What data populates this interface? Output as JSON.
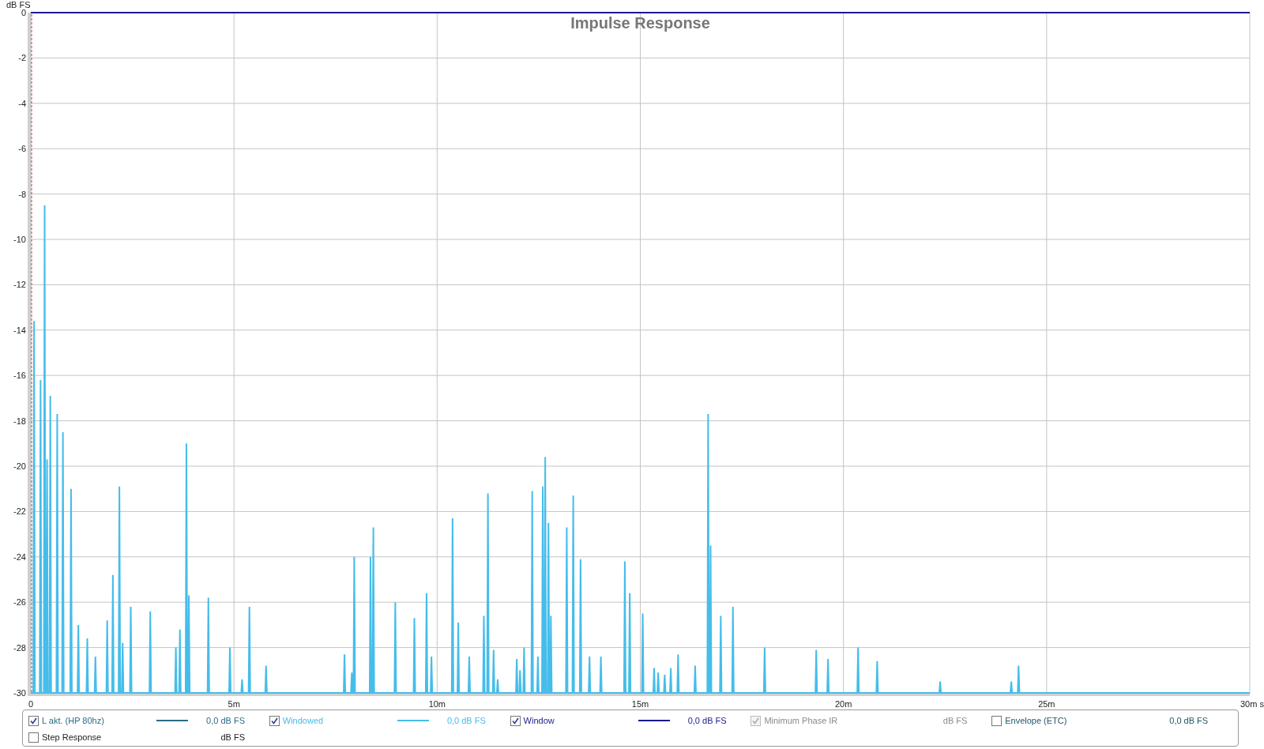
{
  "chart_data": {
    "type": "line",
    "title": "Impulse Response",
    "ylabel": "dB FS",
    "grid": true,
    "x": [
      0,
      0.06,
      0.08,
      0.1,
      0.22,
      0.24,
      0.26,
      0.32,
      0.34,
      0.36,
      0.38,
      0.4,
      0.42,
      0.46,
      0.48,
      0.5,
      0.63,
      0.65,
      0.67,
      0.77,
      0.79,
      0.81,
      0.97,
      0.99,
      1.01,
      1.15,
      1.17,
      1.19,
      1.37,
      1.39,
      1.41,
      1.57,
      1.59,
      1.61,
      1.86,
      1.88,
      1.9,
      2,
      2.02,
      2.04,
      2.16,
      2.18,
      2.2,
      2.24,
      2.26,
      2.28,
      2.44,
      2.46,
      2.48,
      2.92,
      2.94,
      2.96,
      3.55,
      3.57,
      3.59,
      3.65,
      3.67,
      3.69,
      3.81,
      3.83,
      3.85,
      3.87,
      3.89,
      3.91,
      4.35,
      4.37,
      4.39,
      4.88,
      4.9,
      4.92,
      5.18,
      5.2,
      5.22,
      5.36,
      5.38,
      5.4,
      5.77,
      5.79,
      5.81,
      7.7,
      7.72,
      7.74,
      7.88,
      7.9,
      7.92,
      7.94,
      7.96,
      7.98,
      8.34,
      8.36,
      8.38,
      8.41,
      8.43,
      8.45,
      8.95,
      8.97,
      8.99,
      9.42,
      9.44,
      9.46,
      9.72,
      9.74,
      9.76,
      9.84,
      9.86,
      9.88,
      10.36,
      10.38,
      10.4,
      10.5,
      10.52,
      10.54,
      10.77,
      10.79,
      10.81,
      11.13,
      11.15,
      11.17,
      11.23,
      11.25,
      11.27,
      11.37,
      11.39,
      11.41,
      11.47,
      11.49,
      11.51,
      11.94,
      11.96,
      11.98,
      12.02,
      12.04,
      12.06,
      12.12,
      12.14,
      12.16,
      12.32,
      12.34,
      12.36,
      12.46,
      12.48,
      12.5,
      12.58,
      12.6,
      12.62,
      12.64,
      12.66,
      12.68,
      12.72,
      12.74,
      12.76,
      12.78,
      12.8,
      12.82,
      13.17,
      13.19,
      13.21,
      13.33,
      13.35,
      13.37,
      13.51,
      13.53,
      13.55,
      13.73,
      13.75,
      13.77,
      14.01,
      14.03,
      14.05,
      14.6,
      14.62,
      14.64,
      14.72,
      14.74,
      14.76,
      15.04,
      15.06,
      15.08,
      15.32,
      15.34,
      15.36,
      15.42,
      15.44,
      15.46,
      15.58,
      15.6,
      15.62,
      15.73,
      15.75,
      15.77,
      15.91,
      15.93,
      15.95,
      16.33,
      16.35,
      16.37,
      16.65,
      16.67,
      16.69,
      16.71,
      16.73,
      16.75,
      16.96,
      16.98,
      17,
      17.26,
      17.28,
      17.3,
      18.04,
      18.06,
      18.08,
      19.31,
      19.33,
      19.35,
      19.6,
      19.62,
      19.64,
      20.34,
      20.36,
      20.38,
      20.81,
      20.83,
      20.85,
      22.36,
      22.38,
      22.4,
      24.11,
      24.13,
      24.15,
      24.29,
      24.31,
      24.33,
      30
    ],
    "series": [
      {
        "name": "Windowed",
        "color": "#45bdeb",
        "values": [
          -30,
          -30,
          -13.6,
          -30,
          -30,
          -16.2,
          -30,
          -30,
          -8.5,
          -30,
          -30,
          -19.7,
          -30,
          -30,
          -16.9,
          -30,
          -30,
          -17.7,
          -30,
          -30,
          -18.5,
          -30,
          -30,
          -21,
          -30,
          -30,
          -27,
          -30,
          -30,
          -27.6,
          -30,
          -30,
          -28.4,
          -30,
          -30,
          -26.8,
          -30,
          -30,
          -24.8,
          -30,
          -30,
          -20.9,
          -30,
          -30,
          -27.8,
          -30,
          -30,
          -26.2,
          -30,
          -30,
          -26.4,
          -30,
          -30,
          -28,
          -30,
          -30,
          -27.2,
          -30,
          -30,
          -19,
          -30,
          -30,
          -25.7,
          -30,
          -30,
          -25.8,
          -30,
          -30,
          -28,
          -30,
          -30,
          -29.4,
          -30,
          -30,
          -26.2,
          -30,
          -30,
          -28.8,
          -30,
          -30,
          -28.3,
          -30,
          -30,
          -29.1,
          -30,
          -30,
          -24,
          -30,
          -30,
          -24,
          -30,
          -30,
          -22.7,
          -30,
          -30,
          -26,
          -30,
          -30,
          -26.7,
          -30,
          -30,
          -25.6,
          -30,
          -30,
          -28.4,
          -30,
          -30,
          -22.3,
          -30,
          -30,
          -26.9,
          -30,
          -30,
          -28.4,
          -30,
          -30,
          -26.6,
          -30,
          -30,
          -21.2,
          -30,
          -30,
          -28.1,
          -30,
          -30,
          -29.4,
          -30,
          -30,
          -28.5,
          -30,
          -30,
          -29,
          -30,
          -30,
          -28,
          -30,
          -30,
          -21.1,
          -30,
          -30,
          -28.4,
          -30,
          -30,
          -20.9,
          -30,
          -30,
          -19.6,
          -30,
          -30,
          -22.5,
          -30,
          -30,
          -26.6,
          -30,
          -30,
          -22.7,
          -30,
          -30,
          -21.3,
          -30,
          -30,
          -24.1,
          -30,
          -30,
          -28.4,
          -30,
          -30,
          -28.4,
          -30,
          -30,
          -24.2,
          -30,
          -30,
          -25.6,
          -30,
          -30,
          -26.5,
          -30,
          -30,
          -28.9,
          -30,
          -30,
          -29.1,
          -30,
          -30,
          -29.2,
          -30,
          -30,
          -28.9,
          -30,
          -30,
          -28.3,
          -30,
          -30,
          -28.8,
          -30,
          -30,
          -17.7,
          -30,
          -30,
          -23.5,
          -30,
          -30,
          -26.6,
          -30,
          -30,
          -26.2,
          -30,
          -30,
          -28,
          -30,
          -30,
          -28.1,
          -30,
          -30,
          -28.5,
          -30,
          -30,
          -28,
          -30,
          -30,
          -28.6,
          -30,
          -30,
          -29.5,
          -30,
          -30,
          -29.5,
          -30,
          -30,
          -28.8,
          -30,
          -30
        ]
      },
      {
        "name": "Window",
        "color": "#1a1a8c",
        "values": [
          0,
          0,
          0,
          0,
          0,
          0,
          0,
          0,
          0,
          0,
          0,
          0,
          0,
          0,
          0,
          0,
          0,
          0,
          0,
          0,
          0,
          0,
          0,
          0,
          0,
          0,
          0,
          0,
          0,
          0,
          0,
          0,
          0,
          0,
          0,
          0,
          0,
          0,
          0,
          0,
          0,
          0,
          0,
          0,
          0,
          0,
          0,
          0,
          0,
          0,
          0,
          0,
          0,
          0,
          0,
          0,
          0,
          0,
          0,
          0,
          0,
          0,
          0,
          0,
          0,
          0,
          0,
          0,
          0,
          0,
          0,
          0,
          0,
          0,
          0,
          0,
          0,
          0,
          0,
          0,
          0,
          0,
          0,
          0,
          0,
          0,
          0,
          0,
          0,
          0,
          0,
          0,
          0,
          0,
          0,
          0,
          0,
          0,
          0,
          0,
          0,
          0,
          0,
          0,
          0,
          0,
          0,
          0,
          0,
          0,
          0,
          0,
          0,
          0,
          0,
          0,
          0,
          0,
          0,
          0,
          0,
          0,
          0,
          0,
          0,
          0,
          0,
          0,
          0,
          0,
          0,
          0,
          0,
          0,
          0,
          0,
          0,
          0,
          0,
          0,
          0,
          0,
          0,
          0,
          0,
          0,
          0,
          0,
          0,
          0,
          0,
          0,
          0,
          0,
          0,
          0,
          0,
          0,
          0,
          0,
          0,
          0,
          0,
          0,
          0,
          0,
          0,
          0,
          0,
          0,
          0,
          0,
          0,
          0,
          0,
          0,
          0,
          0,
          0,
          0,
          0,
          0,
          0,
          0,
          0,
          0,
          0,
          0,
          0,
          0,
          0,
          0,
          0,
          0,
          0,
          0,
          0,
          0,
          0,
          0,
          0,
          0,
          0,
          0,
          0,
          0,
          0,
          0,
          0,
          0,
          0,
          0,
          0,
          0,
          0,
          0,
          0,
          0,
          0,
          0,
          0,
          0,
          0,
          0,
          0,
          0,
          0,
          0,
          0,
          0,
          0,
          0,
          0
        ]
      }
    ],
    "xlim": [
      0,
      30
    ],
    "ylim": [
      -30,
      0
    ],
    "xticks": [
      0,
      {
        "value": 5,
        "label": "5m"
      },
      {
        "value": 10,
        "label": "10m"
      },
      {
        "value": 15,
        "label": "15m"
      },
      {
        "value": 20,
        "label": "20m"
      },
      {
        "value": 25,
        "label": "25m"
      },
      {
        "value": 30,
        "label": "30m s"
      }
    ],
    "yticks": [
      0,
      -2,
      -4,
      -6,
      -8,
      -10,
      -12,
      -14,
      -16,
      -18,
      -20,
      -22,
      -24,
      -26,
      -28,
      -30
    ]
  },
  "legend": [
    {
      "kind": "trace",
      "label": "L akt. (HP 80hz)",
      "checked": true,
      "disabled": false,
      "line": true,
      "color": "#2a6c88",
      "value": "0,0 dB FS"
    },
    {
      "kind": "series",
      "checked": true,
      "disabled": false,
      "line": true,
      "value": "0,0 dB FS"
    },
    {
      "kind": "series",
      "checked": true,
      "disabled": false,
      "line": true,
      "value": "0,0 dB FS"
    },
    {
      "kind": "trace",
      "label": "Minimum Phase IR",
      "checked": true,
      "disabled": true,
      "line": false,
      "value": "dB FS"
    },
    {
      "kind": "trace",
      "label": "Envelope (ETC)",
      "checked": false,
      "disabled": false,
      "line": false,
      "color": "#1f5566",
      "value": "0,0 dB FS"
    },
    {
      "kind": "trace",
      "label": "Step Response",
      "checked": false,
      "disabled": false,
      "line": false,
      "color": "#222222",
      "value": "dB FS"
    }
  ]
}
